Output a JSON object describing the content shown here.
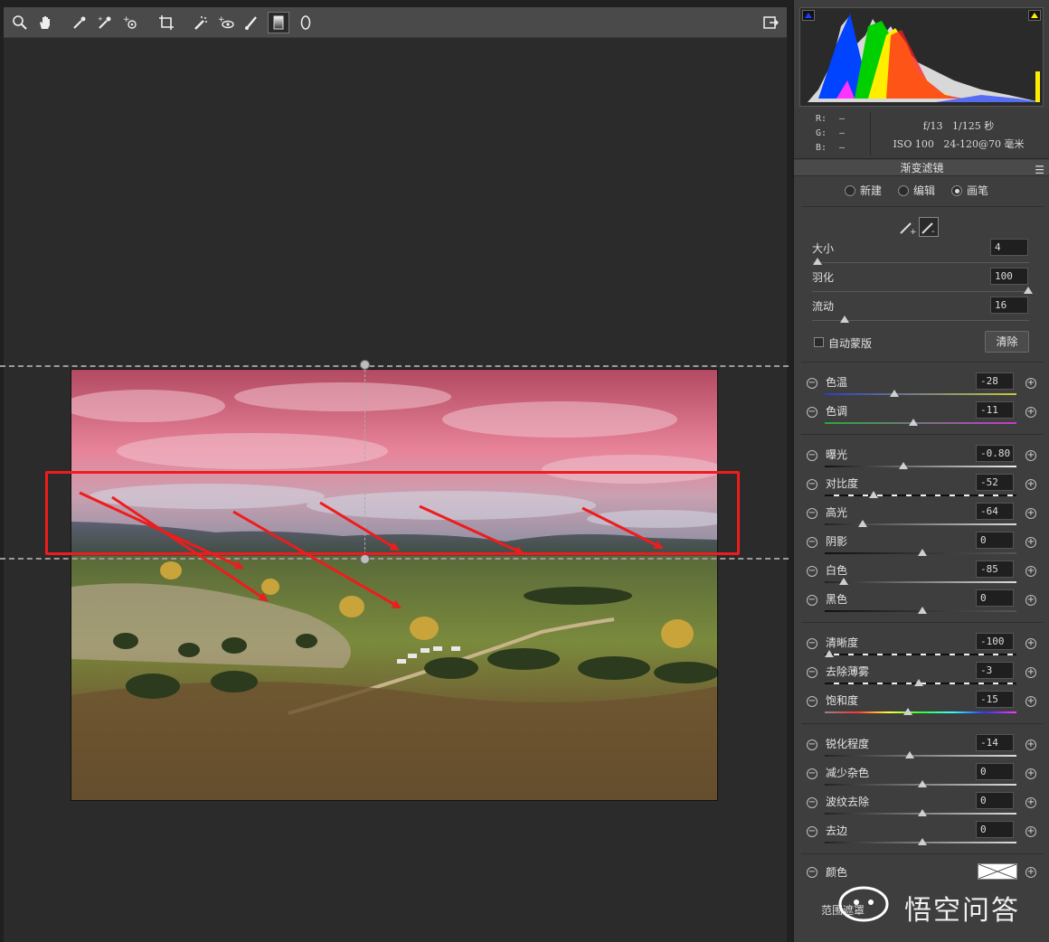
{
  "toolbar": {
    "tools": [
      "zoom-icon",
      "hand-icon",
      "eyedropper-icon",
      "color-sampler-icon",
      "targeted-adjust-icon",
      "crop-icon",
      "spot-removal-icon",
      "red-eye-icon",
      "brush-icon",
      "graduated-filter-icon",
      "radial-filter-icon"
    ],
    "export_icon": "open-image-icon"
  },
  "histogram": {
    "r_label": "R:",
    "g_label": "G:",
    "b_label": "B:",
    "r_value": "—",
    "g_value": "—",
    "b_value": "—",
    "aperture": "f/13",
    "shutter": "1/125 秒",
    "iso": "ISO 100",
    "lens": "24-120@70 毫米"
  },
  "section": {
    "title": "渐变滤镜"
  },
  "mode": {
    "new": "新建",
    "edit": "编辑",
    "brush": "画笔",
    "selected": "brush"
  },
  "brush": {
    "size_label": "大小",
    "size_value": "4",
    "feather_label": "羽化",
    "feather_value": "100",
    "flow_label": "流动",
    "flow_value": "16",
    "auto_mask_label": "自动蒙版",
    "auto_mask": false,
    "clear_label": "清除"
  },
  "sliders": [
    {
      "name": "色温",
      "value": "-28",
      "pos": 0.35,
      "track": "temp"
    },
    {
      "name": "色调",
      "value": "-11",
      "pos": 0.45,
      "track": "tint"
    },
    {
      "name": "曝光",
      "value": "-0.80",
      "pos": 0.4,
      "track": "exposure"
    },
    {
      "name": "对比度",
      "value": "-52",
      "pos": 0.24,
      "track": "contrast"
    },
    {
      "name": "高光",
      "value": "-64",
      "pos": 0.18,
      "track": "gray"
    },
    {
      "name": "阴影",
      "value": "0",
      "pos": 0.5,
      "track": "dark"
    },
    {
      "name": "白色",
      "value": "-85",
      "pos": 0.08,
      "track": "gray"
    },
    {
      "name": "黑色",
      "value": "0",
      "pos": 0.5,
      "track": "dark"
    },
    {
      "name": "清晰度",
      "value": "-100",
      "pos": 0.0,
      "track": "contrast"
    },
    {
      "name": "去除薄雾",
      "value": "-3",
      "pos": 0.48,
      "track": "contrast"
    },
    {
      "name": "饱和度",
      "value": "-15",
      "pos": 0.42,
      "track": "sat"
    },
    {
      "name": "锐化程度",
      "value": "-14",
      "pos": 0.43,
      "track": "gray"
    },
    {
      "name": "减少杂色",
      "value": "0",
      "pos": 0.5,
      "track": "gray"
    },
    {
      "name": "波纹去除",
      "value": "0",
      "pos": 0.5,
      "track": "gray"
    },
    {
      "name": "去边",
      "value": "0",
      "pos": 0.5,
      "track": "gray"
    }
  ],
  "color_row": {
    "name": "颜色"
  },
  "range_mask": {
    "label": "范围遮罩"
  },
  "watermark": {
    "text": "悟空问答"
  },
  "colors": {
    "annotation_red": "#ee1c1c",
    "sky_overlay": "#d85a78"
  }
}
